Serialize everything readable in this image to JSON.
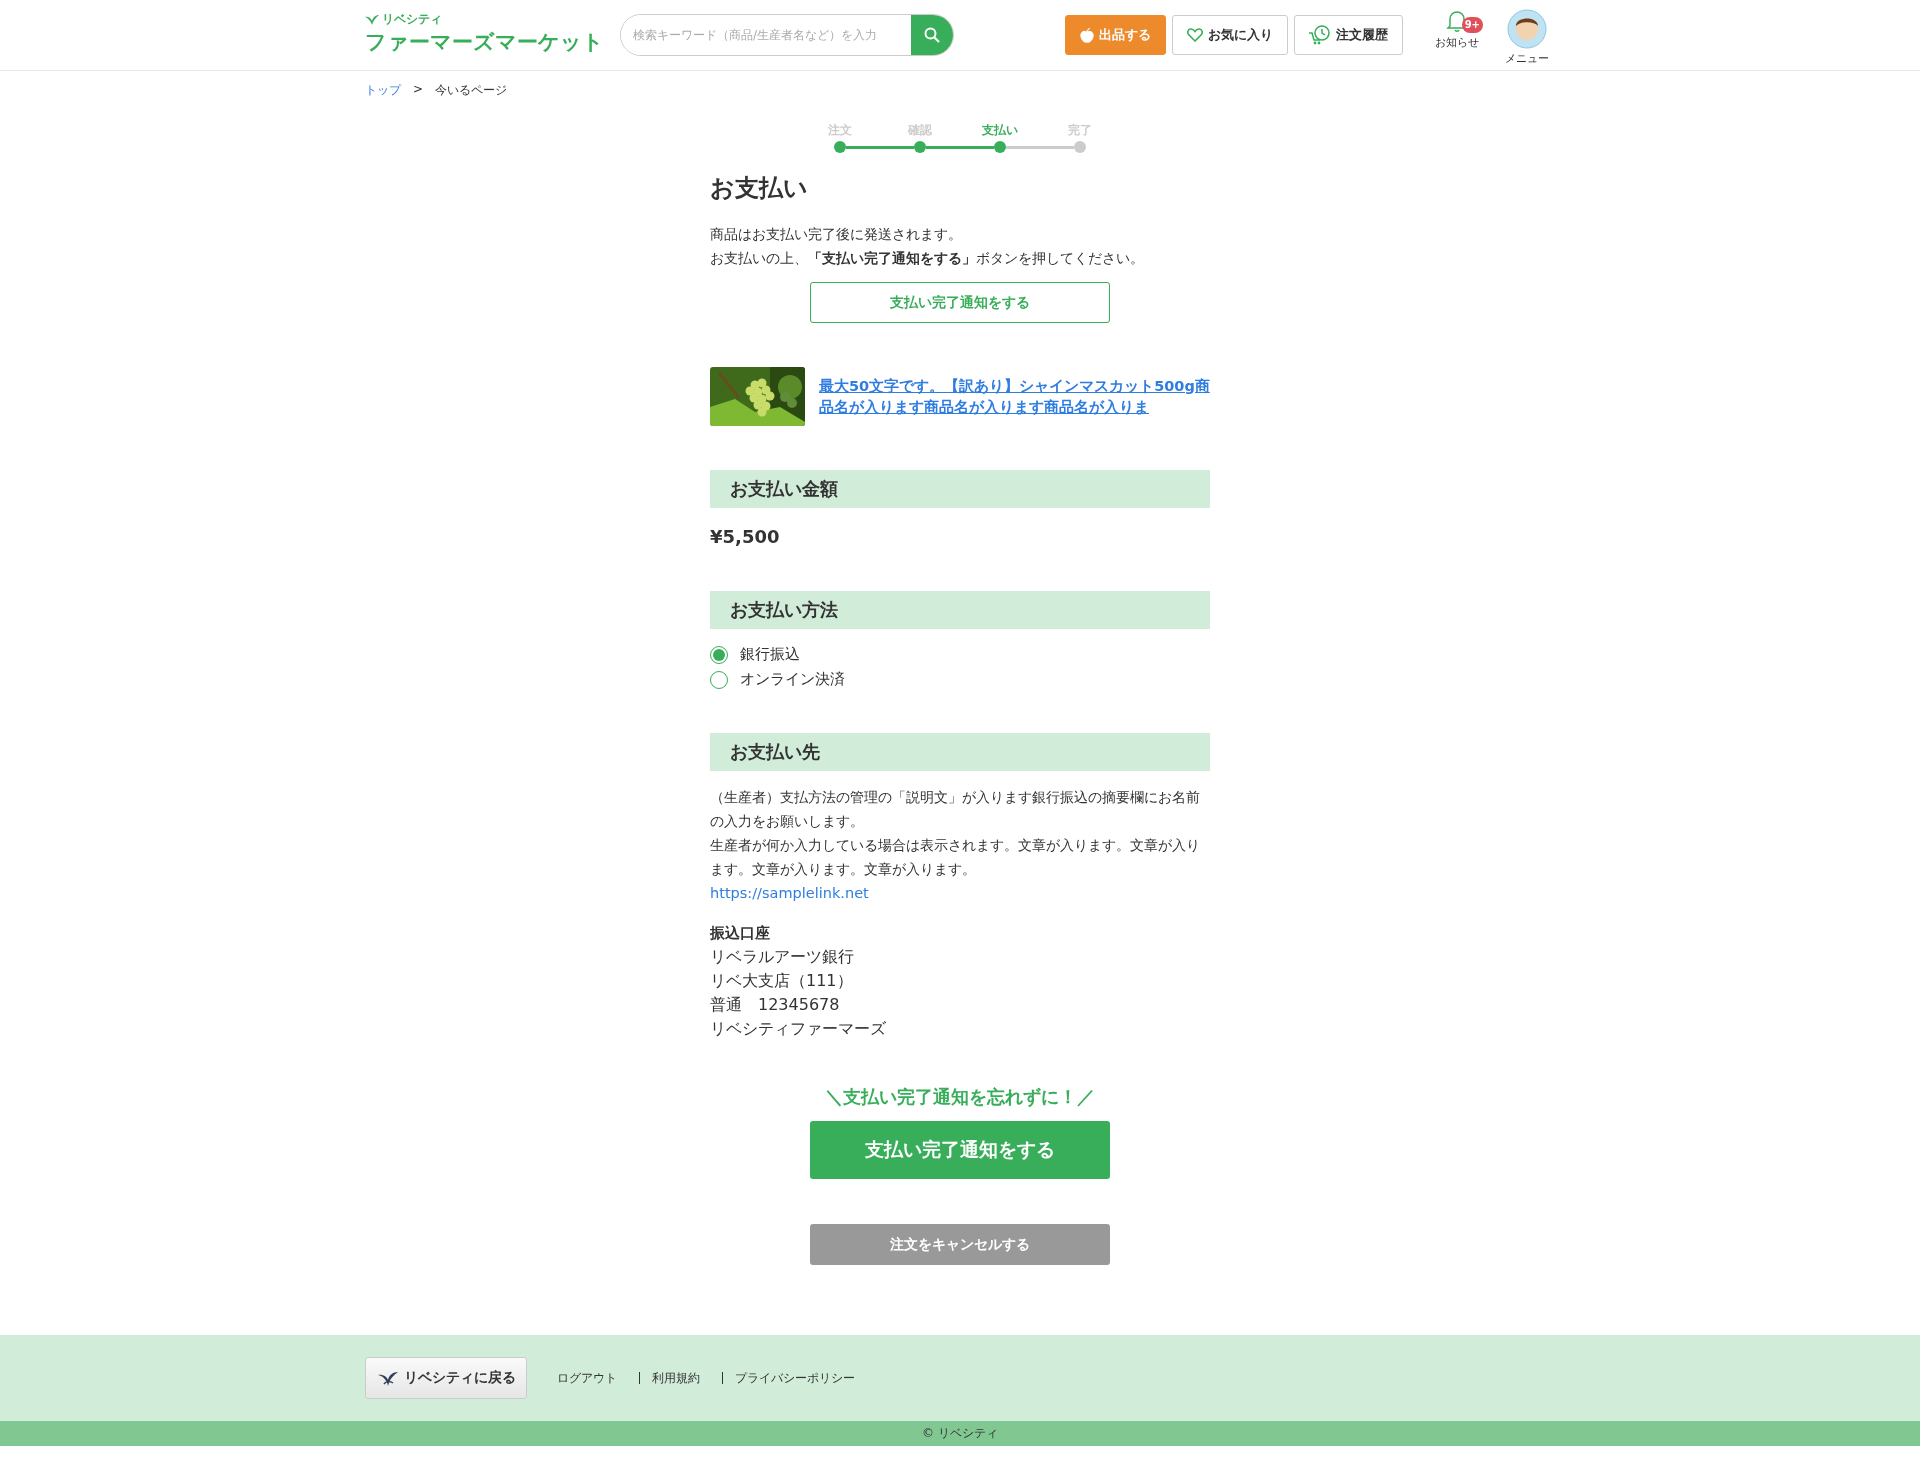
{
  "header": {
    "logo": {
      "tagline": "リベシティ",
      "title": "ファーマーズマーケット"
    },
    "search": {
      "placeholder": "検索キーワード（商品/生産者名など）を入力"
    },
    "actions": [
      {
        "label": "出品する",
        "kind": "primary"
      },
      {
        "label": "お気に入り",
        "kind": "favorite"
      },
      {
        "label": "注文履歴",
        "kind": "history"
      }
    ],
    "notifications": {
      "label": "お知らせ",
      "badge": "9+"
    },
    "menu": {
      "label": "メニュー"
    }
  },
  "breadcrumb": [
    {
      "label": "トップ",
      "kind": "link"
    },
    {
      "label": ">",
      "kind": "separator"
    },
    {
      "label": "今いるページ",
      "kind": "current"
    }
  ],
  "steps": [
    {
      "label": "注文",
      "done": true,
      "selected": false
    },
    {
      "label": "確認",
      "done": true,
      "selected": false
    },
    {
      "label": "支払い",
      "done": true,
      "selected": true
    },
    {
      "label": "完了",
      "done": false,
      "selected": false
    }
  ],
  "title": "お支払い",
  "intro": [
    "商品はお支払い完了後に発送されます。",
    "お支払いの上、**「支払い完了通知をする」**ボタンを押してください。"
  ],
  "notify_button_top": "支払い完了通知をする",
  "product": {
    "name": "最大50文字です。【訳あり】シャインマスカット500g商品名が入ります商品名が入ります商品名が入りま"
  },
  "amount": {
    "heading": "お支払い金額",
    "value": "¥5,500"
  },
  "method": {
    "heading": "お支払い方法",
    "options": [
      {
        "label": "銀行振込",
        "selected": true
      },
      {
        "label": "オンライン決済",
        "selected": false
      }
    ]
  },
  "payee": {
    "heading": "お支払い先",
    "description": [
      "（生産者）支払方法の管理の「説明文」が入ります銀行振込の摘要欄にお名前の入力をお願いします。",
      "生産者が何か入力している場合は表示されます。文章が入ります。文章が入ります。文章が入ります。文章が入ります。"
    ],
    "link": "https://samplelink.net",
    "account": {
      "heading": "振込口座",
      "lines": [
        "リベラルアーツ銀行",
        "リベ大支店（111）",
        "普通　12345678",
        "リベシティファーマーズ"
      ]
    }
  },
  "reminder": "＼支払い完了通知を忘れずに！／",
  "notify_button": "支払い完了通知をする",
  "cancel_button": "注文をキャンセルする",
  "footer": {
    "back_button": "リベシティに戻る",
    "links": [
      "ログアウト",
      "利用規約",
      "プライバシーポリシー"
    ],
    "copyright": "© リベシティ"
  }
}
